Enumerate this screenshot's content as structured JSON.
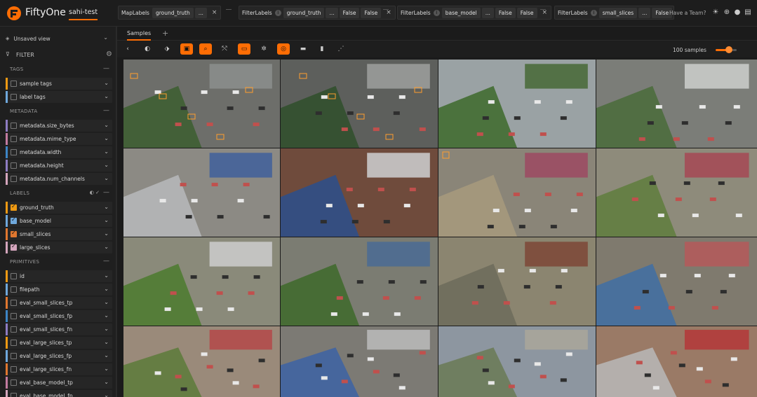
{
  "header": {
    "brand": "FiftyOne",
    "dataset": "sahi-test",
    "have_team": "Have a Team?"
  },
  "stages": [
    {
      "name": "MapLabels",
      "params": [
        "ground_truth",
        "..."
      ]
    },
    {
      "name": "FilterLabels",
      "params": [
        "ground_truth",
        "...",
        "False",
        "False"
      ]
    },
    {
      "name": "FilterLabels",
      "params": [
        "base_model",
        "...",
        "False",
        "False"
      ]
    },
    {
      "name": "FilterLabels",
      "params": [
        "small_slices",
        "...",
        "False"
      ]
    }
  ],
  "sidebar": {
    "view_selector": "Unsaved view",
    "filter_title": "FILTER",
    "groups": [
      {
        "label": "TAGS",
        "items": [
          {
            "name": "sample tags",
            "color": "#ee9a13",
            "checked": false
          },
          {
            "name": "label tags",
            "color": "#6fa8dc",
            "checked": false
          }
        ]
      },
      {
        "label": "METADATA",
        "items": [
          {
            "name": "metadata.size_bytes",
            "color": "#8e7cc3",
            "checked": false
          },
          {
            "name": "metadata.mime_type",
            "color": "#c27ba0",
            "checked": false
          },
          {
            "name": "metadata.width",
            "color": "#3d85c6",
            "checked": false
          },
          {
            "name": "metadata.height",
            "color": "#8e7cc3",
            "checked": false
          },
          {
            "name": "metadata.num_channels",
            "color": "#d5a6bd",
            "checked": false
          }
        ]
      },
      {
        "label": "LABELS",
        "items": [
          {
            "name": "ground_truth",
            "color": "#ee9a13",
            "checked": true
          },
          {
            "name": "base_model",
            "color": "#6fa8dc",
            "checked": true
          },
          {
            "name": "small_slices",
            "color": "#e0772f",
            "checked": true
          },
          {
            "name": "large_slices",
            "color": "#d5a6bd",
            "checked": true
          }
        ]
      },
      {
        "label": "PRIMITIVES",
        "items": [
          {
            "name": "id",
            "color": "#ee9a13",
            "checked": false
          },
          {
            "name": "filepath",
            "color": "#6fa8dc",
            "checked": false
          },
          {
            "name": "eval_small_slices_tp",
            "color": "#e0772f",
            "checked": false
          },
          {
            "name": "eval_small_slices_fp",
            "color": "#3d85c6",
            "checked": false
          },
          {
            "name": "eval_small_slices_fn",
            "color": "#8e7cc3",
            "checked": false
          },
          {
            "name": "eval_large_slices_tp",
            "color": "#ee9a13",
            "checked": false
          },
          {
            "name": "eval_large_slices_fp",
            "color": "#6fa8dc",
            "checked": false
          },
          {
            "name": "eval_large_slices_fn",
            "color": "#e0772f",
            "checked": false
          },
          {
            "name": "eval_base_model_tp",
            "color": "#c27ba0",
            "checked": false
          },
          {
            "name": "eval_base_model_fp",
            "color": "#d5a6bd",
            "checked": false
          }
        ]
      }
    ]
  },
  "main": {
    "tab_label": "Samples",
    "sample_count": "100 samples"
  },
  "colors": {
    "accent": "#ff6d04",
    "background": "#1b1b1b",
    "panel": "#262626"
  }
}
